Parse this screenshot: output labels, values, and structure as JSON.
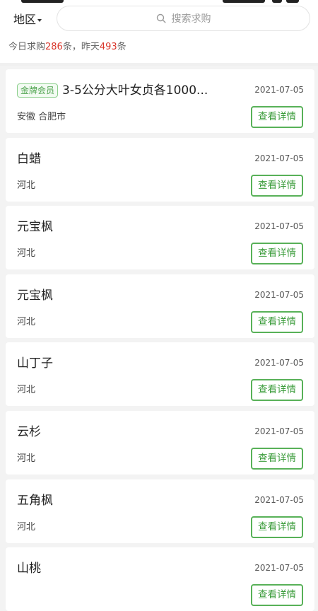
{
  "filter": {
    "region_label": "地区"
  },
  "search": {
    "placeholder": "搜索求购"
  },
  "summary": {
    "today_prefix": "今日求购",
    "today_count": "286",
    "today_suffix": "条，昨天",
    "yesterday_count": "493",
    "yesterday_suffix": "条"
  },
  "colors": {
    "accent_green": "#58b158",
    "count_red": "#d9362b"
  },
  "detail_label": "查看详情",
  "items": [
    {
      "badge": "金牌会员",
      "title": "3-5公分大叶女贞各1000...",
      "date": "2021-07-05",
      "location": "安徽 合肥市"
    },
    {
      "badge": "",
      "title": "白蜡",
      "date": "2021-07-05",
      "location": "河北"
    },
    {
      "badge": "",
      "title": "元宝枫",
      "date": "2021-07-05",
      "location": "河北"
    },
    {
      "badge": "",
      "title": "元宝枫",
      "date": "2021-07-05",
      "location": "河北"
    },
    {
      "badge": "",
      "title": "山丁子",
      "date": "2021-07-05",
      "location": "河北"
    },
    {
      "badge": "",
      "title": "云杉",
      "date": "2021-07-05",
      "location": "河北"
    },
    {
      "badge": "",
      "title": "五角枫",
      "date": "2021-07-05",
      "location": "河北"
    },
    {
      "badge": "",
      "title": "山桃",
      "date": "2021-07-05",
      "location": ""
    }
  ]
}
